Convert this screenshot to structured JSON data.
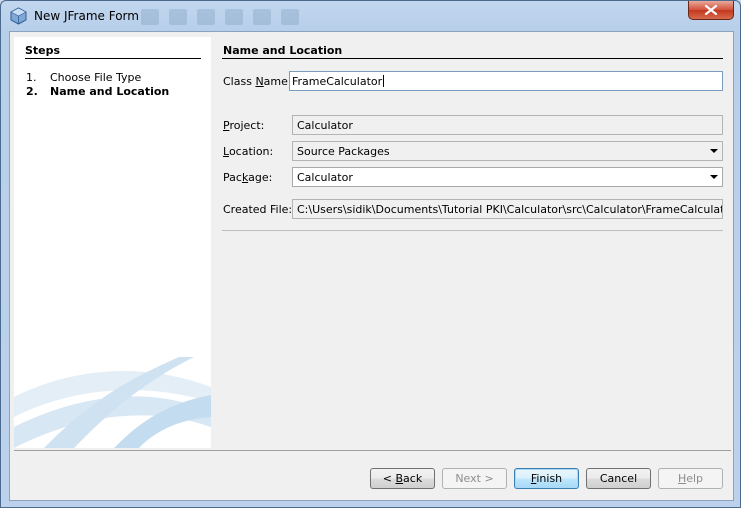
{
  "window": {
    "title": "New JFrame Form"
  },
  "steps": {
    "title": "Steps",
    "items": [
      {
        "num": "1.",
        "label": "Choose File Type"
      },
      {
        "num": "2.",
        "label": "Name and Location"
      }
    ]
  },
  "form": {
    "section_title": "Name and Location",
    "class_name": {
      "label_pre": "Class ",
      "label_mnemonic": "N",
      "label_post": "ame:",
      "value": "FrameCalculator"
    },
    "project": {
      "label_mnemonic": "P",
      "label_post": "roject:",
      "value": "Calculator"
    },
    "location": {
      "label_mnemonic": "L",
      "label_post": "ocation:",
      "value": "Source Packages"
    },
    "package": {
      "label_pre": "Pac",
      "label_mnemonic": "k",
      "label_post": "age:",
      "value": "Calculator"
    },
    "created_file": {
      "label_pre": "Created File:",
      "value": "C:\\Users\\sidik\\Documents\\Tutorial PKI\\Calculator\\src\\Calculator\\FrameCalculator.java"
    }
  },
  "buttons": {
    "back": {
      "pre": "< ",
      "mnemonic": "B",
      "post": "ack"
    },
    "next": {
      "label": "Next >"
    },
    "finish": {
      "mnemonic": "F",
      "post": "inish"
    },
    "cancel": {
      "label": "Cancel"
    },
    "help": {
      "mnemonic": "H",
      "post": "elp"
    }
  }
}
